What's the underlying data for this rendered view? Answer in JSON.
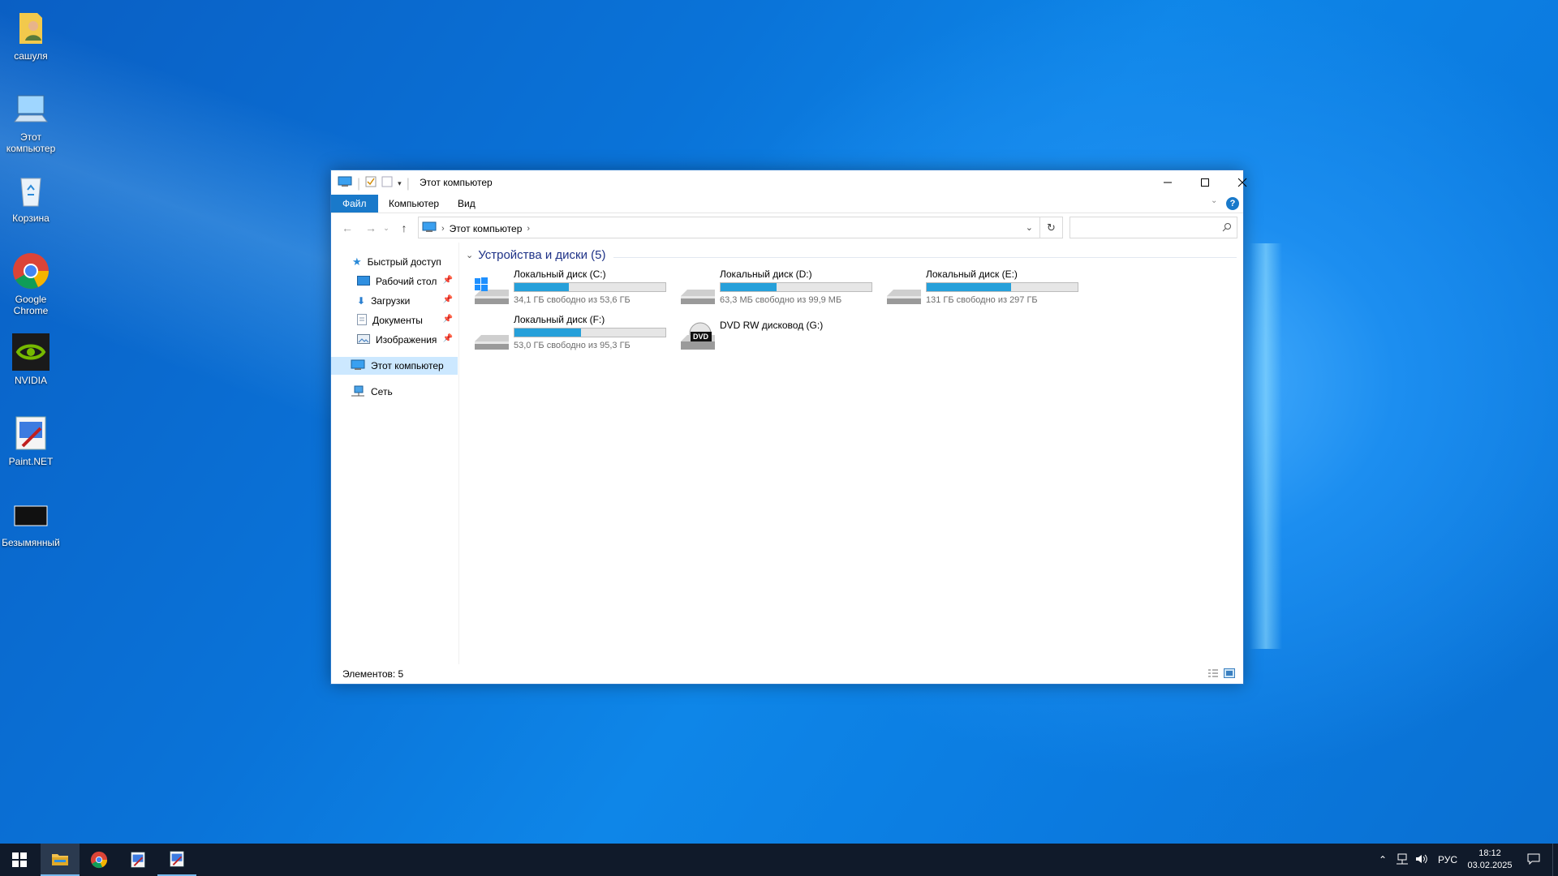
{
  "desktop": {
    "icons": [
      {
        "label": "сашуля",
        "icon": "user-folder-icon"
      },
      {
        "label": "Этот компьютер",
        "icon": "computer-icon"
      },
      {
        "label": "Корзина",
        "icon": "recycle-bin-icon"
      },
      {
        "label": "Google Chrome",
        "icon": "chrome-icon"
      },
      {
        "label": "NVIDIA",
        "icon": "nvidia-icon"
      },
      {
        "label": "Paint.NET",
        "icon": "paintnet-icon"
      },
      {
        "label": "Безымянный",
        "icon": "image-file-icon"
      }
    ]
  },
  "window": {
    "title": "Этот компьютер",
    "ribbon_tabs": [
      "Файл",
      "Компьютер",
      "Вид"
    ],
    "address": {
      "crumbs": [
        "Этот компьютер"
      ]
    },
    "search_placeholder": "",
    "sidebar": {
      "quick_access": "Быстрый доступ",
      "pinned": [
        "Рабочий стол",
        "Загрузки",
        "Документы",
        "Изображения"
      ],
      "this_pc": "Этот компьютер",
      "network": "Сеть"
    },
    "group_title": "Устройства и диски (5)",
    "drives": [
      {
        "name": "Локальный диск (C:)",
        "free": "34,1 ГБ свободно из 53,6 ГБ",
        "used_fraction": 0.36,
        "type": "system"
      },
      {
        "name": "Локальный диск (D:)",
        "free": "63,3 МБ свободно из 99,9 МБ",
        "used_fraction": 0.37,
        "type": "hdd"
      },
      {
        "name": "Локальный диск (E:)",
        "free": "131 ГБ свободно из 297 ГБ",
        "used_fraction": 0.56,
        "type": "hdd"
      },
      {
        "name": "Локальный диск (F:)",
        "free": "53,0 ГБ свободно из 95,3 ГБ",
        "used_fraction": 0.44,
        "type": "hdd"
      },
      {
        "name": "DVD RW дисковод (G:)",
        "free": "",
        "type": "dvd",
        "dvd_label": "DVD"
      }
    ],
    "status": "Элементов: 5"
  },
  "taskbar": {
    "language": "РУС",
    "time": "18:12",
    "date": "03.02.2025"
  },
  "colors": {
    "accent": "#1979ca",
    "drive_fill": "#26a0da",
    "group_title": "#1e3287"
  }
}
